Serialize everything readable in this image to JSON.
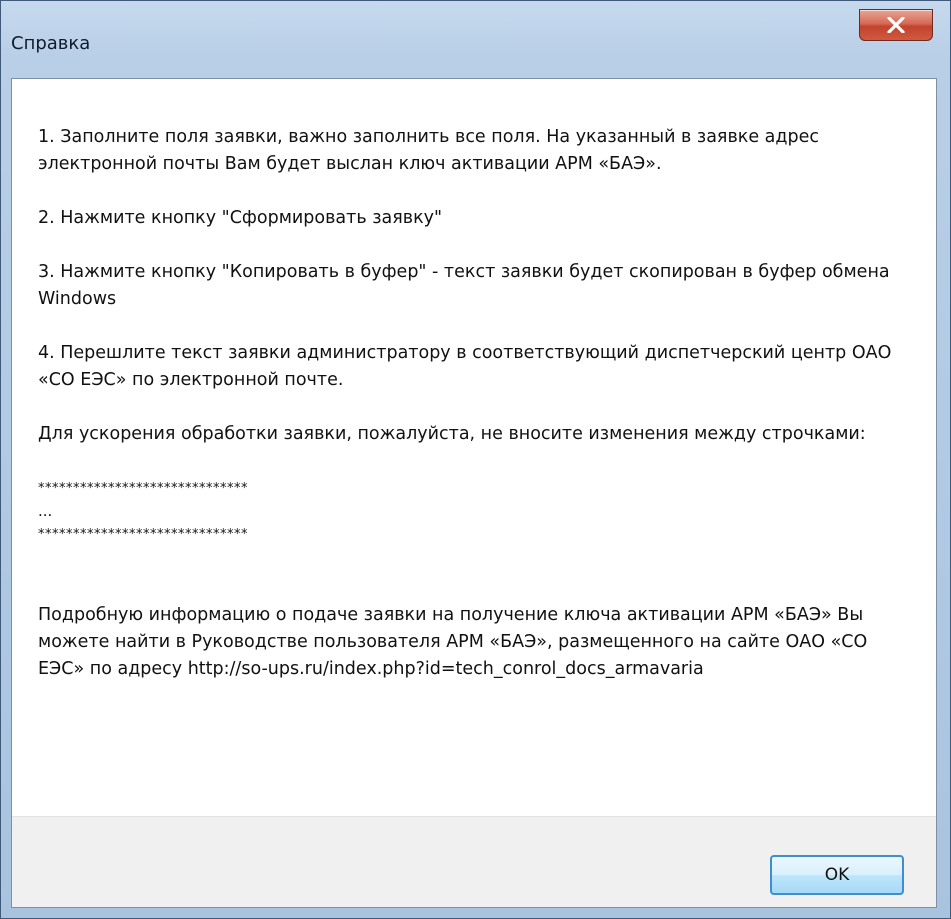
{
  "window": {
    "title": "Справка"
  },
  "content": {
    "step1": "1. Заполните поля заявки, важно заполнить все поля. На указанный в заявке адрес электронной почты Вам будет выслан ключ активации АРМ «БАЭ».",
    "step2": "2. Нажмите кнопку \"Сформировать заявку\"",
    "step3": "3. Нажмите кнопку \"Копировать в буфер\" - текст заявки будет скопирован в буфер обмена Windows",
    "step4": "4. Перешлите текст заявки администратору в соответствующий диспетчерский центр ОАО «СО ЕЭС» по электронной почте.",
    "note": "Для ускорения обработки заявки, пожалуйста, не вносите изменения между строчками:",
    "separator_top": "******************************",
    "ellipsis": "...",
    "separator_bottom": "******************************",
    "info": "Подробную информацию о подаче заявки на получение ключа активации АРМ «БАЭ» Вы можете найти в Руководстве пользователя АРМ «БАЭ», размещенного на сайте ОАО «СО ЕЭС» по адресу http://so-ups.ru/index.php?id=tech_conrol_docs_armavaria"
  },
  "footer": {
    "ok_label": "OK"
  },
  "icons": {
    "close": "close-icon"
  },
  "colors": {
    "close_button": "#c2432e",
    "ok_border": "#3c8fd1"
  }
}
